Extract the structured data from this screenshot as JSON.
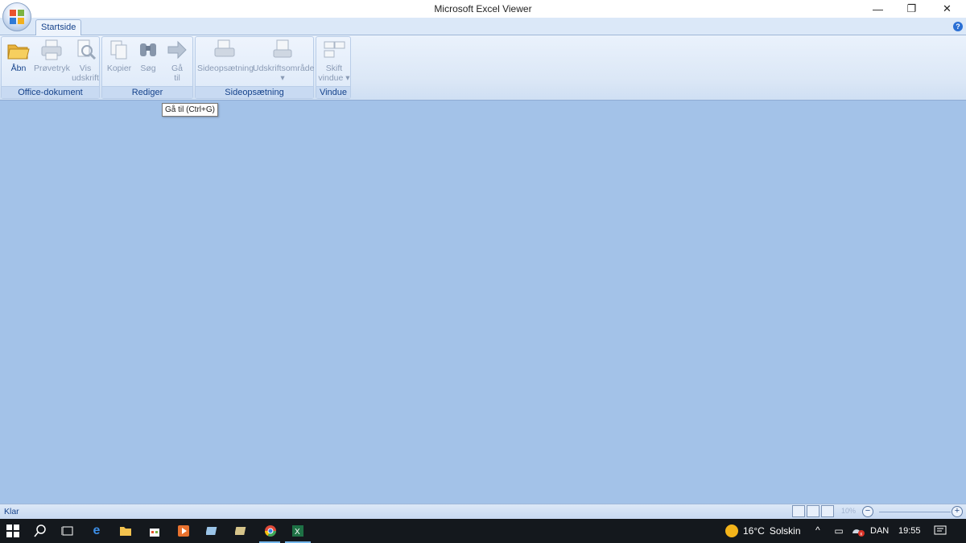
{
  "window": {
    "title": "Microsoft Excel Viewer",
    "minimize": "—",
    "restore": "❐",
    "close": "✕"
  },
  "tabs": {
    "active": "Startside"
  },
  "ribbon": {
    "groups": [
      {
        "label": "Office-dokument",
        "buttons": [
          "Åbn",
          "Prøvetryk",
          "Vis udskrift"
        ]
      },
      {
        "label": "Rediger",
        "buttons": [
          "Kopier",
          "Søg",
          "Gå til"
        ]
      },
      {
        "label": "Sideopsætning",
        "buttons": [
          "Sideopsætning",
          "Udskriftsområde"
        ]
      },
      {
        "label": "Vindue",
        "buttons": [
          "Skift vindue"
        ]
      }
    ],
    "open": "Åbn",
    "print_preview": "Prøvetryk",
    "show_print_line1": "Vis",
    "show_print_line2": "udskrift",
    "copy": "Kopier",
    "find": "Søg",
    "goto_line1": "Gå",
    "goto_line2": "til",
    "page_setup": "Sideopsætning",
    "print_area": "Udskriftsområde",
    "switch_line1": "Skift",
    "switch_line2": "vindue",
    "group_office": "Office-dokument",
    "group_edit": "Rediger",
    "group_page": "Sideopsætning",
    "group_window": "Vindue"
  },
  "tooltip": "Gå til (Ctrl+G)",
  "status": {
    "text": "Klar",
    "zoom": "10%"
  },
  "taskbar": {
    "weather_temp": "16°C",
    "weather_desc": "Solskin",
    "language": "DAN",
    "time": "19:55"
  },
  "colors": {
    "workspace": "#a3c2e8",
    "accent": "#15428b",
    "taskbar": "#14181d"
  }
}
